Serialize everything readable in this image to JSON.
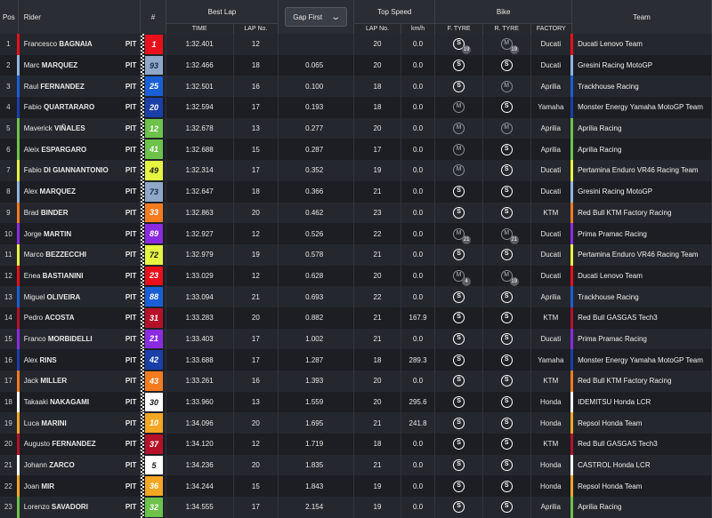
{
  "headers": {
    "pos": "Pos",
    "rider": "Rider",
    "num": "#",
    "best_lap": "Best Lap",
    "time": "TIME",
    "lap_no": "LAP No.",
    "gap_first": "Gap First",
    "top_speed": "Top Speed",
    "ts_lap_no": "LAP No.",
    "kmh": "km/h",
    "bike": "Bike",
    "f_tyre": "F. TYRE",
    "r_tyre": "R. TYRE",
    "factory": "FACTORY",
    "team": "Team"
  },
  "rows": [
    {
      "pos": "1",
      "first": "Francesco",
      "last": "BAGNAIA",
      "pit": "PIT",
      "num": "1",
      "color": "#e8101a",
      "fg": "#ffffff",
      "time": "1:32.401",
      "lap": "12",
      "gap": "",
      "tslap": "20",
      "kmh": "0.0",
      "ft": "S",
      "ftsub": "19",
      "rt": "M",
      "rtsub": "19",
      "factory": "Ducati",
      "team": "Ducati Lenovo Team",
      "teamcolor": "#e8101a"
    },
    {
      "pos": "2",
      "first": "Marc",
      "last": "MARQUEZ",
      "pit": "PIT",
      "num": "93",
      "color": "#8fa8c8",
      "fg": "#1b2a4a",
      "time": "1:32.466",
      "lap": "18",
      "gap": "0.065",
      "tslap": "20",
      "kmh": "0.0",
      "ft": "S",
      "ftsub": "",
      "rt": "S",
      "rtsub": "",
      "factory": "Ducati",
      "team": "Gresini Racing MotoGP",
      "teamcolor": "#8fb4e0"
    },
    {
      "pos": "3",
      "first": "Raul",
      "last": "FERNANDEZ",
      "pit": "PIT",
      "num": "25",
      "color": "#1a5fd6",
      "fg": "#ffffff",
      "time": "1:32.501",
      "lap": "16",
      "gap": "0.100",
      "tslap": "18",
      "kmh": "0.0",
      "ft": "S",
      "ftsub": "",
      "rt": "M",
      "rtsub": "",
      "factory": "Aprilia",
      "team": "Trackhouse Racing",
      "teamcolor": "#1a5fd6"
    },
    {
      "pos": "4",
      "first": "Fabio",
      "last": "QUARTARARO",
      "pit": "PIT",
      "num": "20",
      "color": "#1b3fa8",
      "fg": "#ffffff",
      "time": "1:32.594",
      "lap": "17",
      "gap": "0.193",
      "tslap": "18",
      "kmh": "0.0",
      "ft": "M",
      "ftsub": "",
      "rt": "S",
      "rtsub": "",
      "factory": "Yamaha",
      "team": "Monster Energy Yamaha MotoGP Team",
      "teamcolor": "#1b3fa8"
    },
    {
      "pos": "5",
      "first": "Maverick",
      "last": "VIÑALES",
      "pit": "PIT",
      "num": "12",
      "color": "#6cc24a",
      "fg": "#ffffff",
      "time": "1:32.678",
      "lap": "13",
      "gap": "0.277",
      "tslap": "20",
      "kmh": "0.0",
      "ft": "M",
      "ftsub": "",
      "rt": "M",
      "rtsub": "",
      "factory": "Aprilia",
      "team": "Aprilia Racing",
      "teamcolor": "#6cc24a"
    },
    {
      "pos": "6",
      "first": "Aleix",
      "last": "ESPARGARO",
      "pit": "PIT",
      "num": "41",
      "color": "#6cc24a",
      "fg": "#ffffff",
      "time": "1:32.688",
      "lap": "15",
      "gap": "0.287",
      "tslap": "17",
      "kmh": "0.0",
      "ft": "M",
      "ftsub": "",
      "rt": "S",
      "rtsub": "",
      "factory": "Aprilia",
      "team": "Aprilia Racing",
      "teamcolor": "#6cc24a"
    },
    {
      "pos": "7",
      "first": "Fabio",
      "last": "DI GIANNANTONIO",
      "pit": "PIT",
      "num": "49",
      "color": "#e6f542",
      "fg": "#1a1a1a",
      "time": "1:32.314",
      "lap": "17",
      "gap": "0.352",
      "tslap": "19",
      "kmh": "0.0",
      "ft": "M",
      "ftsub": "",
      "rt": "S",
      "rtsub": "",
      "factory": "Ducati",
      "team": "Pertamina Enduro VR46 Racing Team",
      "teamcolor": "#e6f542"
    },
    {
      "pos": "8",
      "first": "Alex",
      "last": "MARQUEZ",
      "pit": "PIT",
      "num": "73",
      "color": "#8fa8c8",
      "fg": "#1b2a4a",
      "time": "1:32.647",
      "lap": "18",
      "gap": "0.366",
      "tslap": "21",
      "kmh": "0.0",
      "ft": "S",
      "ftsub": "",
      "rt": "S",
      "rtsub": "",
      "factory": "Ducati",
      "team": "Gresini Racing MotoGP",
      "teamcolor": "#8fb4e0"
    },
    {
      "pos": "9",
      "first": "Brad",
      "last": "BINDER",
      "pit": "PIT",
      "num": "33",
      "color": "#f47b20",
      "fg": "#ffffff",
      "time": "1:32.863",
      "lap": "20",
      "gap": "0.462",
      "tslap": "23",
      "kmh": "0.0",
      "ft": "S",
      "ftsub": "",
      "rt": "S",
      "rtsub": "",
      "factory": "KTM",
      "team": "Red Bull KTM Factory Racing",
      "teamcolor": "#f47b20"
    },
    {
      "pos": "10",
      "first": "Jorge",
      "last": "MARTIN",
      "pit": "PIT",
      "num": "89",
      "color": "#8a2be2",
      "fg": "#ffffff",
      "time": "1:32.927",
      "lap": "12",
      "gap": "0.526",
      "tslap": "22",
      "kmh": "0.0",
      "ft": "M",
      "ftsub": "21",
      "rt": "M",
      "rtsub": "21",
      "factory": "Ducati",
      "team": "Prima Pramac Racing",
      "teamcolor": "#8a2be2"
    },
    {
      "pos": "11",
      "first": "Marco",
      "last": "BEZZECCHI",
      "pit": "PIT",
      "num": "72",
      "color": "#e6f542",
      "fg": "#1a1a1a",
      "time": "1:32.979",
      "lap": "19",
      "gap": "0.578",
      "tslap": "21",
      "kmh": "0.0",
      "ft": "S",
      "ftsub": "",
      "rt": "S",
      "rtsub": "",
      "factory": "Ducati",
      "team": "Pertamina Enduro VR46 Racing Team",
      "teamcolor": "#e6f542"
    },
    {
      "pos": "12",
      "first": "Enea",
      "last": "BASTIANINI",
      "pit": "PIT",
      "num": "23",
      "color": "#e8101a",
      "fg": "#ffffff",
      "time": "1:33.029",
      "lap": "12",
      "gap": "0.628",
      "tslap": "20",
      "kmh": "0.0",
      "ft": "M",
      "ftsub": "4",
      "rt": "M",
      "rtsub": "19",
      "factory": "Ducati",
      "team": "Ducati Lenovo Team",
      "teamcolor": "#e8101a"
    },
    {
      "pos": "13",
      "first": "Miguel",
      "last": "OLIVEIRA",
      "pit": "PIT",
      "num": "88",
      "color": "#1a5fd6",
      "fg": "#ffffff",
      "time": "1:33.094",
      "lap": "21",
      "gap": "0.693",
      "tslap": "22",
      "kmh": "0.0",
      "ft": "S",
      "ftsub": "",
      "rt": "S",
      "rtsub": "",
      "factory": "Aprilia",
      "team": "Trackhouse Racing",
      "teamcolor": "#1a5fd6"
    },
    {
      "pos": "14",
      "first": "Pedro",
      "last": "ACOSTA",
      "pit": "PIT",
      "num": "31",
      "color": "#b5122a",
      "fg": "#ffffff",
      "time": "1:33.283",
      "lap": "20",
      "gap": "0.882",
      "tslap": "21",
      "kmh": "167.9",
      "ft": "S",
      "ftsub": "",
      "rt": "S",
      "rtsub": "",
      "factory": "KTM",
      "team": "Red Bull GASGAS Tech3",
      "teamcolor": "#b5122a"
    },
    {
      "pos": "15",
      "first": "Franco",
      "last": "MORBIDELLI",
      "pit": "PIT",
      "num": "21",
      "color": "#8a2be2",
      "fg": "#ffffff",
      "time": "1:33.403",
      "lap": "17",
      "gap": "1.002",
      "tslap": "21",
      "kmh": "0.0",
      "ft": "S",
      "ftsub": "",
      "rt": "S",
      "rtsub": "",
      "factory": "Ducati",
      "team": "Prima Pramac Racing",
      "teamcolor": "#8a2be2"
    },
    {
      "pos": "16",
      "first": "Alex",
      "last": "RINS",
      "pit": "PIT",
      "num": "42",
      "color": "#1b3fa8",
      "fg": "#ffffff",
      "time": "1:33.688",
      "lap": "17",
      "gap": "1.287",
      "tslap": "18",
      "kmh": "289.3",
      "ft": "S",
      "ftsub": "",
      "rt": "S",
      "rtsub": "",
      "factory": "Yamaha",
      "team": "Monster Energy Yamaha MotoGP Team",
      "teamcolor": "#1b3fa8"
    },
    {
      "pos": "17",
      "first": "Jack",
      "last": "MILLER",
      "pit": "PIT",
      "num": "43",
      "color": "#f47b20",
      "fg": "#ffffff",
      "time": "1:33.261",
      "lap": "16",
      "gap": "1.393",
      "tslap": "20",
      "kmh": "0.0",
      "ft": "S",
      "ftsub": "",
      "rt": "S",
      "rtsub": "",
      "factory": "KTM",
      "team": "Red Bull KTM Factory Racing",
      "teamcolor": "#f47b20"
    },
    {
      "pos": "18",
      "first": "Takaaki",
      "last": "NAKAGAMI",
      "pit": "PIT",
      "num": "30",
      "color": "#ffffff",
      "fg": "#1a1a1a",
      "time": "1:33.960",
      "lap": "13",
      "gap": "1.559",
      "tslap": "20",
      "kmh": "295.6",
      "ft": "S",
      "ftsub": "",
      "rt": "S",
      "rtsub": "",
      "factory": "Honda",
      "team": "IDEMITSU Honda LCR",
      "teamcolor": "#ffffff"
    },
    {
      "pos": "19",
      "first": "Luca",
      "last": "MARINI",
      "pit": "PIT",
      "num": "10",
      "color": "#f5a623",
      "fg": "#ffffff",
      "time": "1:34.096",
      "lap": "20",
      "gap": "1.695",
      "tslap": "21",
      "kmh": "241.8",
      "ft": "S",
      "ftsub": "",
      "rt": "S",
      "rtsub": "",
      "factory": "Honda",
      "team": "Repsol Honda Team",
      "teamcolor": "#f5a623"
    },
    {
      "pos": "20",
      "first": "Augusto",
      "last": "FERNANDEZ",
      "pit": "PIT",
      "num": "37",
      "color": "#b5122a",
      "fg": "#ffffff",
      "time": "1:34.120",
      "lap": "12",
      "gap": "1.719",
      "tslap": "18",
      "kmh": "0.0",
      "ft": "S",
      "ftsub": "",
      "rt": "S",
      "rtsub": "",
      "factory": "KTM",
      "team": "Red Bull GASGAS Tech3",
      "teamcolor": "#b5122a"
    },
    {
      "pos": "21",
      "first": "Johann",
      "last": "ZARCO",
      "pit": "PIT",
      "num": "5",
      "color": "#ffffff",
      "fg": "#1a1a1a",
      "time": "1:34.236",
      "lap": "20",
      "gap": "1.835",
      "tslap": "21",
      "kmh": "0.0",
      "ft": "S",
      "ftsub": "",
      "rt": "S",
      "rtsub": "",
      "factory": "Honda",
      "team": "CASTROL Honda LCR",
      "teamcolor": "#ffffff"
    },
    {
      "pos": "22",
      "first": "Joan",
      "last": "MIR",
      "pit": "PIT",
      "num": "36",
      "color": "#f5a623",
      "fg": "#ffffff",
      "time": "1:34.244",
      "lap": "15",
      "gap": "1.843",
      "tslap": "19",
      "kmh": "0.0",
      "ft": "S",
      "ftsub": "",
      "rt": "S",
      "rtsub": "",
      "factory": "Honda",
      "team": "Repsol Honda Team",
      "teamcolor": "#f5a623"
    },
    {
      "pos": "23",
      "first": "Lorenzo",
      "last": "SAVADORI",
      "pit": "PIT",
      "num": "32",
      "color": "#6cc24a",
      "fg": "#ffffff",
      "time": "1:34.555",
      "lap": "17",
      "gap": "2.154",
      "tslap": "19",
      "kmh": "0.0",
      "ft": "S",
      "ftsub": "",
      "rt": "S",
      "rtsub": "",
      "factory": "Aprilia",
      "team": "Aprilia Racing",
      "teamcolor": "#6cc24a"
    }
  ]
}
